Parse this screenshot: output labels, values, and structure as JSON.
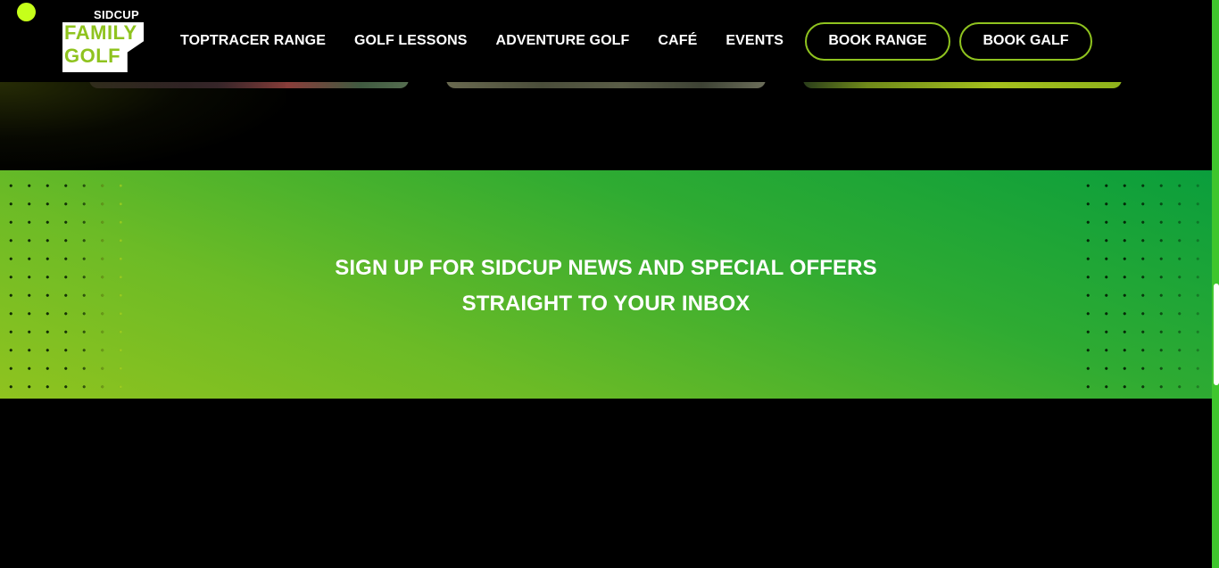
{
  "brand": {
    "logo_top": "SIDCUP",
    "logo_line1": "FAMILY",
    "logo_line2": "GOLF",
    "colors": {
      "accent_lime": "#8fc31f",
      "ball_yellow": "#c6ff1a",
      "banner_green_dark": "#0a9e3c",
      "banner_green_light": "#8fc31f",
      "background": "#000000"
    }
  },
  "nav": {
    "items": [
      {
        "label": "TOPTRACER RANGE"
      },
      {
        "label": "GOLF LESSONS"
      },
      {
        "label": "ADVENTURE GOLF"
      },
      {
        "label": "CAFÉ"
      },
      {
        "label": "EVENTS"
      }
    ],
    "book_range_label": "BOOK RANGE",
    "book_galf_label": "BOOK GALF"
  },
  "signup": {
    "line1": "SIGN UP FOR SIDCUP NEWS AND SPECIAL OFFERS",
    "line2": "STRAIGHT TO YOUR INBOX"
  },
  "icons": {
    "ball": "golf-ball-icon"
  }
}
